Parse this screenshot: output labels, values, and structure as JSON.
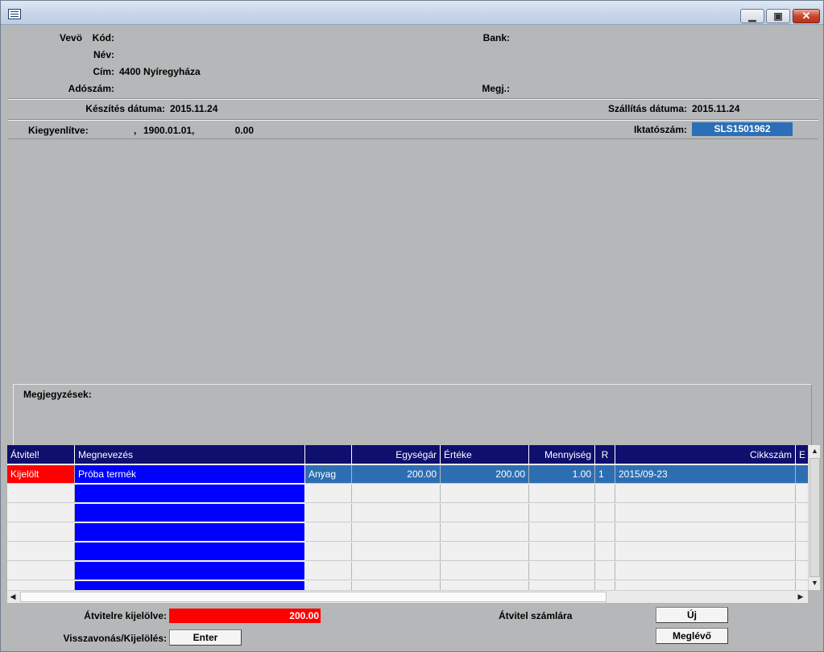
{
  "header": {
    "vevo_label": "Vevö",
    "kod_label": "Kód:",
    "kod_value": "",
    "nev_label": "Név:",
    "nev_value": "",
    "cim_label": "Cím:",
    "cim_value": "4400 Nyíregyháza",
    "adoszam_label": "Adószám:",
    "adoszam_value": "",
    "bank_label": "Bank:",
    "bank_value": "",
    "megj_label": "Megj.:",
    "megj_value": ""
  },
  "dates": {
    "keszites_label": "Készítés dátuma:",
    "keszites_value": "2015.11.24",
    "szallitas_label": "Szállítás dátuma:",
    "szallitas_value": "2015.11.24"
  },
  "status": {
    "kiegyenlitve_label": "Kiegyenlítve:",
    "kiegyenlitve_sep": ",",
    "kiegyenlitve_date": "1900.01.01,",
    "kiegyenlitve_amount": "0.00",
    "iktatoszam_label": "Iktatószám:",
    "iktatoszam_value": "SLS1501962"
  },
  "notes": {
    "label": "Megjegyzések:"
  },
  "table": {
    "headers": [
      "Átvitel!",
      "Megnevezés",
      "",
      "Egységár",
      "Értéke",
      "Mennyiség",
      "R",
      "Cikkszám",
      "E"
    ],
    "rows": [
      [
        "Kijelölt",
        "Próba termék",
        "Anyag",
        "200.00",
        "200.00",
        "1.00",
        "1",
        "2015/09-23",
        ""
      ]
    ]
  },
  "footer": {
    "kijelolve_label": "Átvitelre kijelölve:",
    "kijelolve_value": "200.00",
    "visszavonas_label": "Visszavonás/Kijelölés:",
    "enter_button": "Enter",
    "atvitel_label": "Átvitel számlára",
    "uj_button": "Új",
    "meglevo_button": "Meglévő"
  },
  "colors": {
    "header_bg": "#0f0f6e",
    "selected_red": "#ff0000",
    "name_blue": "#0000ff",
    "row_steel": "#2d6eb3"
  }
}
